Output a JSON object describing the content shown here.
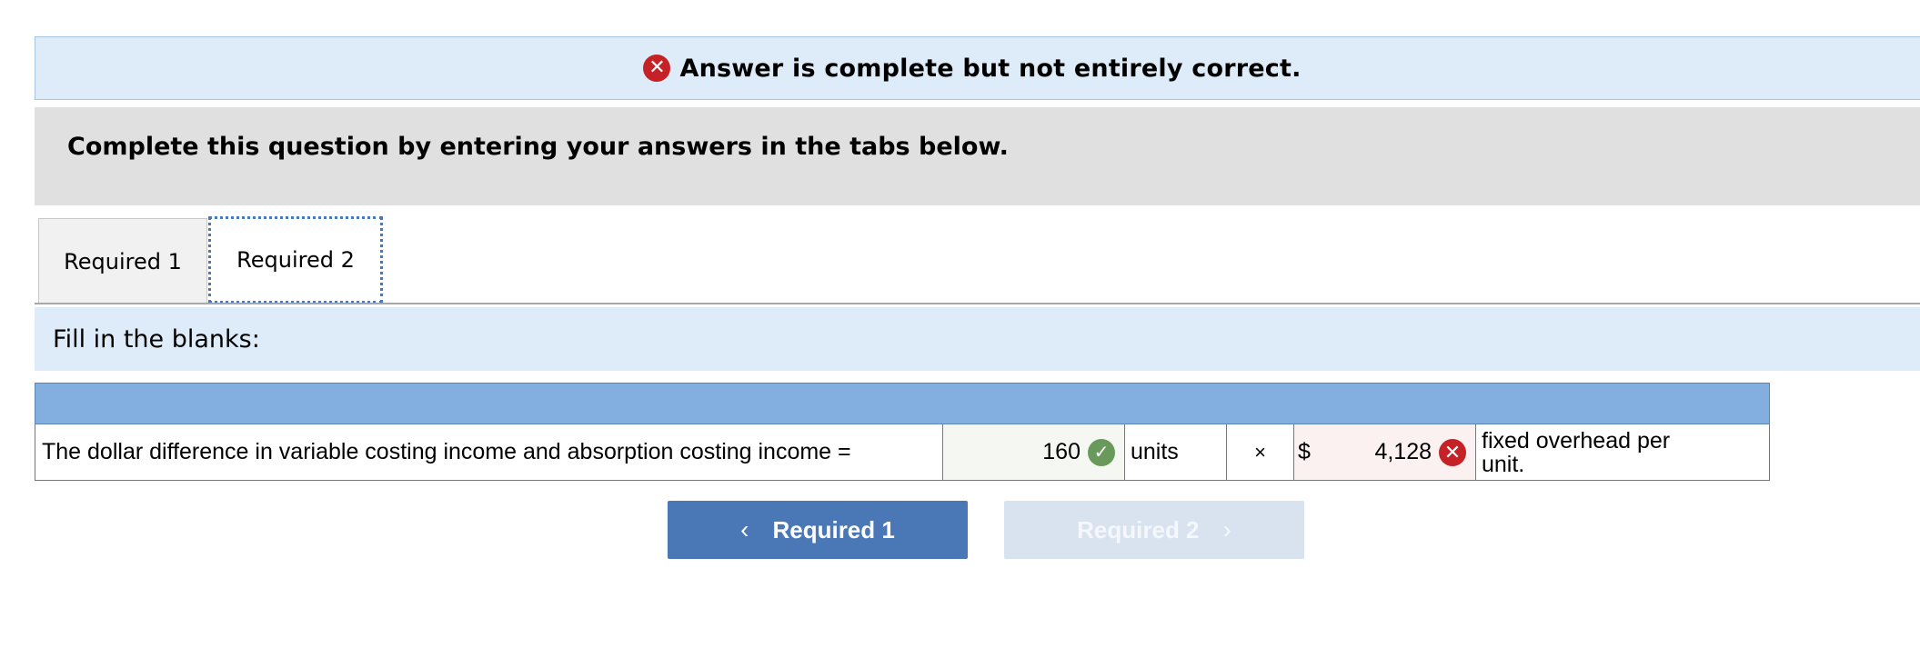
{
  "banner": {
    "icon": "x-circle-icon",
    "text": "Answer is complete but not entirely correct."
  },
  "instructions": "Complete this question by entering your answers in the tabs below.",
  "tabs": [
    {
      "label": "Required 1",
      "active": false
    },
    {
      "label": "Required 2",
      "active": true
    }
  ],
  "section_label": "Fill in the blanks:",
  "row": {
    "description": "The dollar difference in variable costing income and absorption costing income =",
    "units_value": "160",
    "units_status": "correct",
    "units_label": "units",
    "times_symbol": "×",
    "dollar_sign": "$",
    "dollar_value": "4,128",
    "dollar_status": "incorrect",
    "suffix": "fixed overhead per unit."
  },
  "nav": {
    "prev_label": "Required 1",
    "next_label": "Required 2",
    "next_enabled": false
  },
  "colors": {
    "correct": "#6a9a5b",
    "incorrect": "#c52228",
    "accent": "#4a77b5"
  }
}
